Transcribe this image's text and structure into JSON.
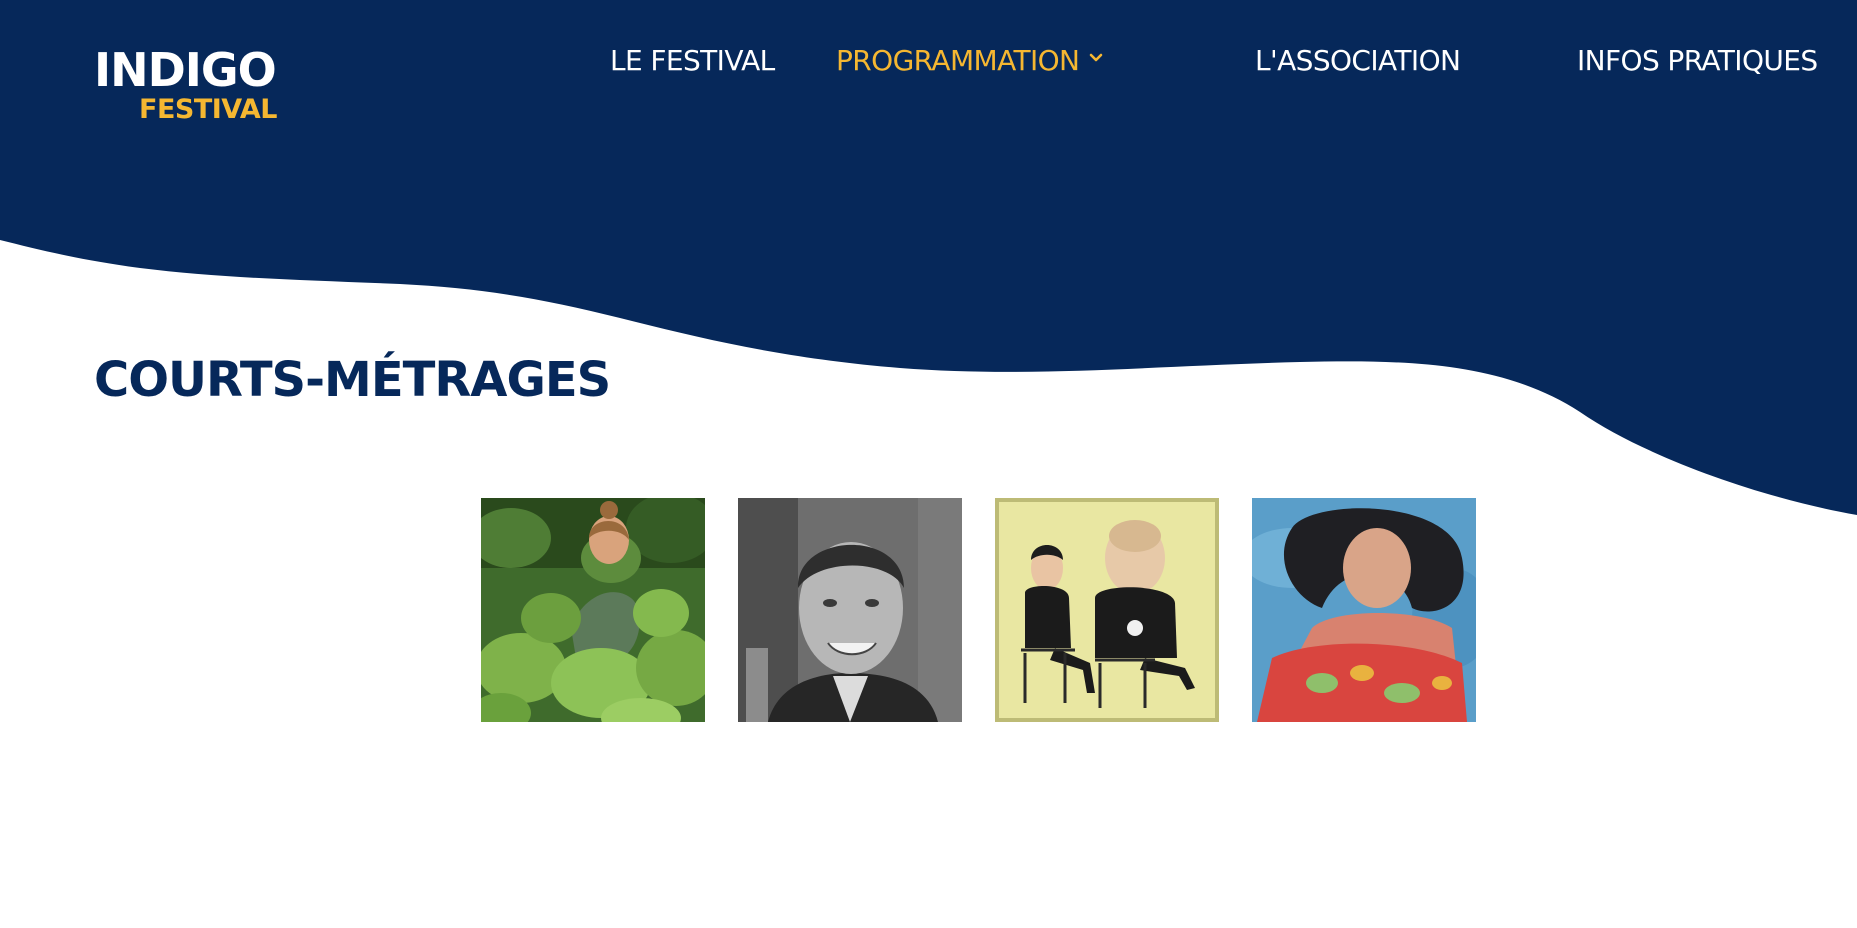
{
  "colors": {
    "navy": "#06285a",
    "gold": "#f5b731",
    "white": "#ffffff"
  },
  "logo": {
    "line1": "INDIGO",
    "line2": "FESTIVAL"
  },
  "nav": {
    "items": [
      {
        "label": "LE FESTIVAL",
        "active": false,
        "has_dropdown": false
      },
      {
        "label": "PROGRAMMATION",
        "active": true,
        "has_dropdown": true,
        "icon": "chevron-down-icon"
      },
      {
        "label": "L'ASSOCIATION",
        "active": false,
        "has_dropdown": false
      },
      {
        "label": "INFOS PRATIQUES",
        "active": false,
        "has_dropdown": false
      }
    ]
  },
  "main": {
    "title": "COURTS-MÉTRAGES",
    "films": [
      {
        "image": "woman-in-garden-photo"
      },
      {
        "image": "young-man-smiling-bw-photo"
      },
      {
        "image": "illustrated-seated-figures-drawing"
      },
      {
        "image": "woman-floating-in-water-photo"
      }
    ]
  }
}
